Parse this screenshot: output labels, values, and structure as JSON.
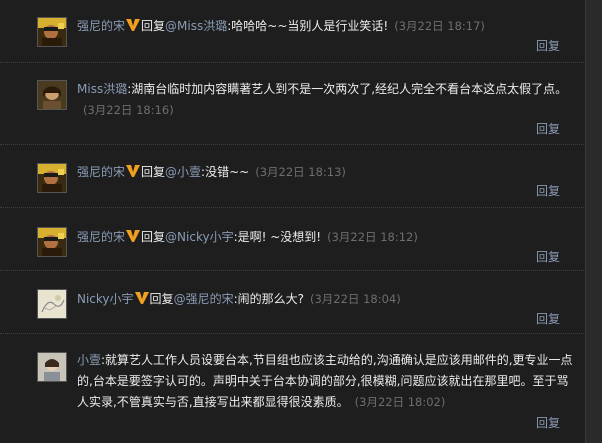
{
  "reply_label": "回复",
  "comments": [
    {
      "user": "强尼的宋",
      "reply_prefix": "回复",
      "reply_to": "@Miss洪璐",
      "text": ":哈哈哈~~当别人是行业笑话!",
      "time": "(3月22日 18:17)",
      "avatar": "avatar-man-yellow"
    },
    {
      "user": "Miss洪璐",
      "reply_prefix": "",
      "reply_to": "",
      "text": ":湖南台临时加内容瞒著艺人到不是一次两次了,经纪人完全不看台本这点太假了点。",
      "time": "(3月22日 18:16)",
      "avatar": "avatar-woman-dark"
    },
    {
      "user": "强尼的宋",
      "reply_prefix": "回复",
      "reply_to": "@小壹",
      "text": ":没错~~",
      "time": "(3月22日 18:13)",
      "avatar": "avatar-man-yellow"
    },
    {
      "user": "强尼的宋",
      "reply_prefix": "回复",
      "reply_to": "@Nicky小宇",
      "text": ":是啊! ~没想到!",
      "time": "(3月22日 18:12)",
      "avatar": "avatar-man-yellow"
    },
    {
      "user": "Nicky小宇",
      "reply_prefix": "回复",
      "reply_to": "@强尼的宋",
      "text": ":闹的那么大?",
      "time": "(3月22日 18:04)",
      "avatar": "avatar-sketch-light"
    },
    {
      "user": "小壹",
      "reply_prefix": "",
      "reply_to": "",
      "text": ":就算艺人工作人员设要台本,节目组也应该主动给的,沟通确认是应该用邮件的,更专业一点的,台本是要签字认可的。声明中关于台本协调的部分,很模糊,问题应该就出在那里吧。至于骂人实录,不管真实与否,直接写出来都显得很没素质。",
      "time": "(3月22日 18:02)",
      "avatar": "avatar-woman-light"
    }
  ],
  "colors": {
    "background": "#1e1e1e",
    "link": "#8a9bb4",
    "text": "#ececec",
    "time": "#6e6e6e",
    "vip_badge": "#f0a020"
  }
}
